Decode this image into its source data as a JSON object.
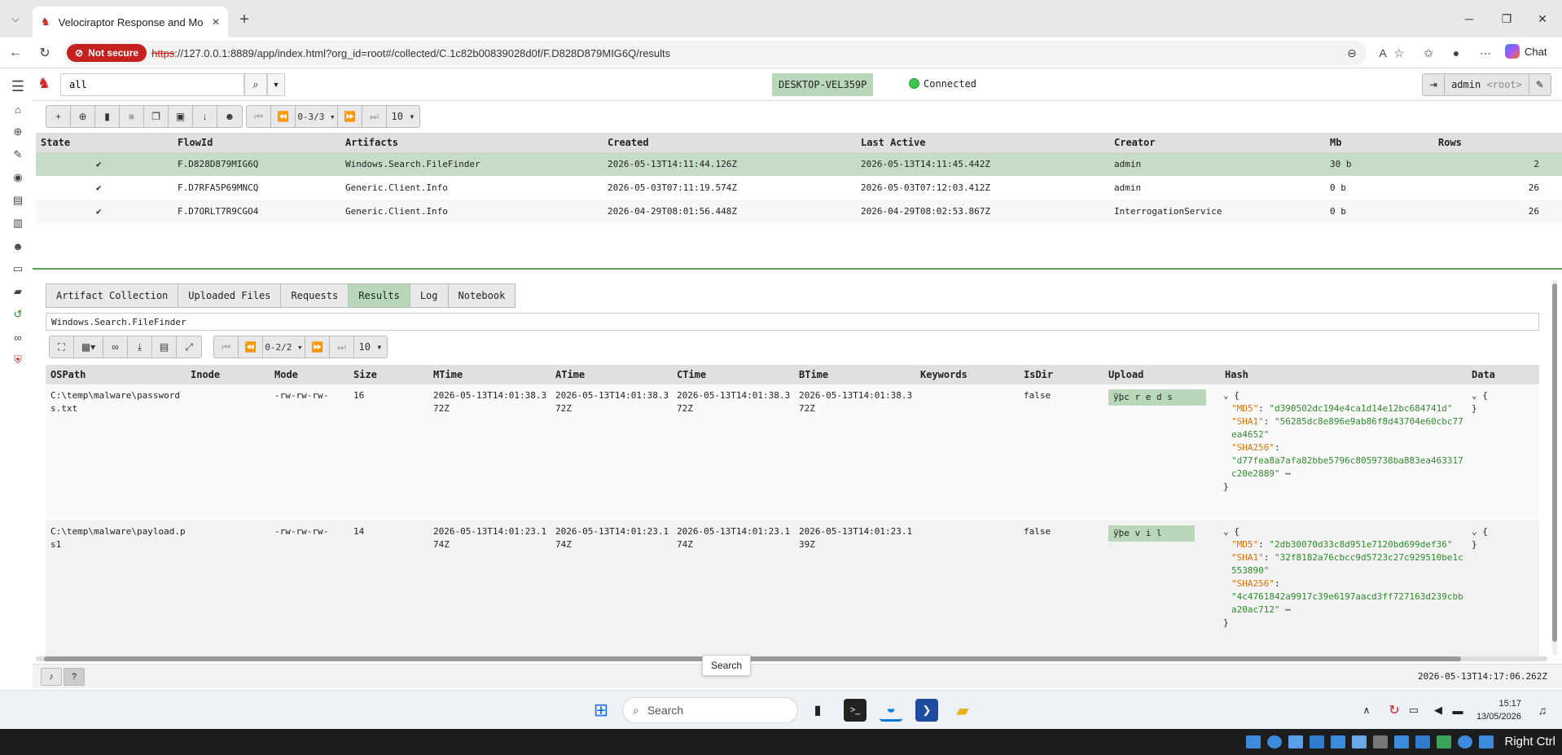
{
  "browser": {
    "tab_title": "Velociraptor Response and Monito",
    "close_glyph": "✕",
    "new_tab_glyph": "+",
    "not_secure": "Not secure",
    "url_scheme": "https",
    "url_rest": "://127.0.0.1:8889/app/index.html?org_id=root#/collected/C.1c82b00839028d0f/F.D828D879MIG6Q/results",
    "chat_label": "Chat"
  },
  "app": {
    "search_value": "all",
    "client_id": "DESKTOP-VEL359P",
    "connection_status": "Connected",
    "user": "admin",
    "org": "<root>"
  },
  "flows_toolbar": {
    "pager": "0-3/3",
    "page_size": "10"
  },
  "flows_table": {
    "columns": [
      "State",
      "FlowId",
      "Artifacts",
      "Created",
      "Last Active",
      "Creator",
      "Mb",
      "Rows"
    ],
    "rows": [
      {
        "state": "✔",
        "flow_id": "F.D828D879MIG6Q",
        "artifacts": "Windows.Search.FileFinder",
        "created": "2026-05-13T14:11:44.126Z",
        "last_active": "2026-05-13T14:11:45.442Z",
        "creator": "admin",
        "mb": "30 b",
        "rows": "2"
      },
      {
        "state": "✔",
        "flow_id": "F.D7RFA5P69MNCQ",
        "artifacts": "Generic.Client.Info",
        "created": "2026-05-03T07:11:19.574Z",
        "last_active": "2026-05-03T07:12:03.412Z",
        "creator": "admin",
        "mb": "0 b",
        "rows": "26"
      },
      {
        "state": "✔",
        "flow_id": "F.D7ORLT7R9CGO4",
        "artifacts": "Generic.Client.Info",
        "created": "2026-04-29T08:01:56.448Z",
        "last_active": "2026-04-29T08:02:53.867Z",
        "creator": "InterrogationService",
        "mb": "0 b",
        "rows": "26"
      }
    ]
  },
  "detail_tabs": [
    "Artifact Collection",
    "Uploaded Files",
    "Requests",
    "Results",
    "Log",
    "Notebook"
  ],
  "artifact_name": "Windows.Search.FileFinder",
  "results_toolbar": {
    "pager": "0-2/2",
    "page_size": "10"
  },
  "results_table": {
    "columns": [
      "OSPath",
      "Inode",
      "Mode",
      "Size",
      "MTime",
      "ATime",
      "CTime",
      "BTime",
      "Keywords",
      "IsDir",
      "Upload",
      "Hash",
      "Data"
    ],
    "rows": [
      {
        "ospath": "C:\\temp\\malware\\passwords.txt",
        "inode": "",
        "mode": "-rw-rw-rw-",
        "size": "16",
        "mtime": "2026-05-13T14:01:38.372Z",
        "atime": "2026-05-13T14:01:38.372Z",
        "ctime": "2026-05-13T14:01:38.372Z",
        "btime": "2026-05-13T14:01:38.372Z",
        "keywords": "",
        "isdir": "false",
        "upload": "ÿþc r e d s",
        "md5_key": "\"MD5\"",
        "md5": "\"d390502dc194e4ca1d14e12bc684741d\"",
        "sha1_key": "\"SHA1\"",
        "sha1": "\"56285dc8e896e9ab86f8d43704e60cbc77ea4652\"",
        "sha256_key": "\"SHA256\"",
        "sha256": "\"d77fea8a7afa82bbe5796c8059738ba883ea463317c20e2889\"",
        "ellipsis": "⋯",
        "data_open": "{",
        "data_close": "}"
      },
      {
        "ospath": "C:\\temp\\malware\\payload.ps1",
        "inode": "",
        "mode": "-rw-rw-rw-",
        "size": "14",
        "mtime": "2026-05-13T14:01:23.174Z",
        "atime": "2026-05-13T14:01:23.174Z",
        "ctime": "2026-05-13T14:01:23.174Z",
        "btime": "2026-05-13T14:01:23.139Z",
        "keywords": "",
        "isdir": "false",
        "upload": "ÿþe v i l",
        "md5_key": "\"MD5\"",
        "md5": "\"2db30070d33c8d951e7120bd699def36\"",
        "sha1_key": "\"SHA1\"",
        "sha1": "\"32f8182a76cbcc9d5723c27c929510be1c553890\"",
        "sha256_key": "\"SHA256\"",
        "sha256": "\"4c4761842a9917c39e6197aacd3ff727163d239cbba20ac712\"",
        "ellipsis": "⋯",
        "data_open": "{",
        "data_close": "}"
      }
    ]
  },
  "tooltip": "Search",
  "footer_time": "2026-05-13T14:17:06.262Z",
  "taskbar": {
    "search_placeholder": "Search",
    "time": "15:17",
    "date": "13/05/2026"
  },
  "vm": {
    "host_key": "Right Ctrl"
  },
  "colors": {
    "selected_row": "#c7dcc7",
    "accent_green": "#b9d8b9",
    "not_secure": "#c5221f",
    "hash_key": "#d9730d",
    "hash_value": "#2e8b2e"
  }
}
